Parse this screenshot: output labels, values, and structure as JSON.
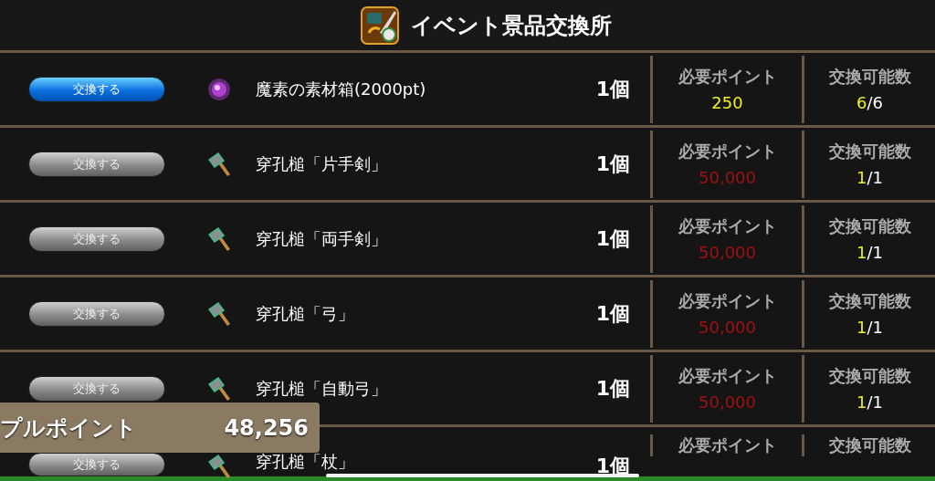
{
  "header": {
    "title": "イベント景品交換所"
  },
  "rows": [
    {
      "button": "交換する",
      "disabled": false,
      "kind": "orb",
      "name": "魔素の素材箱(2000pt)",
      "quantity": "1個",
      "points_label": "必要ポイント",
      "points": "250",
      "affordable": true,
      "count_label": "交換可能数",
      "remaining": "6",
      "total": "/6"
    },
    {
      "button": "交換する",
      "disabled": true,
      "kind": "hammer",
      "name": "穿孔槌「片手剣」",
      "quantity": "1個",
      "points_label": "必要ポイント",
      "points": "50,000",
      "affordable": false,
      "count_label": "交換可能数",
      "remaining": "1",
      "total": "/1"
    },
    {
      "button": "交換する",
      "disabled": true,
      "kind": "hammer",
      "name": "穿孔槌「両手剣」",
      "quantity": "1個",
      "points_label": "必要ポイント",
      "points": "50,000",
      "affordable": false,
      "count_label": "交換可能数",
      "remaining": "1",
      "total": "/1"
    },
    {
      "button": "交換する",
      "disabled": true,
      "kind": "hammer",
      "name": "穿孔槌「弓」",
      "quantity": "1個",
      "points_label": "必要ポイント",
      "points": "50,000",
      "affordable": false,
      "count_label": "交換可能数",
      "remaining": "1",
      "total": "/1"
    },
    {
      "button": "交換する",
      "disabled": true,
      "kind": "hammer",
      "name": "穿孔槌「自動弓」",
      "quantity": "1個",
      "points_label": "必要ポイント",
      "points": "50,000",
      "affordable": false,
      "count_label": "交換可能数",
      "remaining": "1",
      "total": "/1"
    },
    {
      "button": "交換する",
      "disabled": true,
      "kind": "hammer",
      "name": "穿孔槌「杖」",
      "quantity": "1個",
      "points_label": "必要ポイント",
      "count_label": "交換可能数"
    }
  ],
  "points_panel": {
    "label": "プルポイント",
    "value": "48,256"
  }
}
